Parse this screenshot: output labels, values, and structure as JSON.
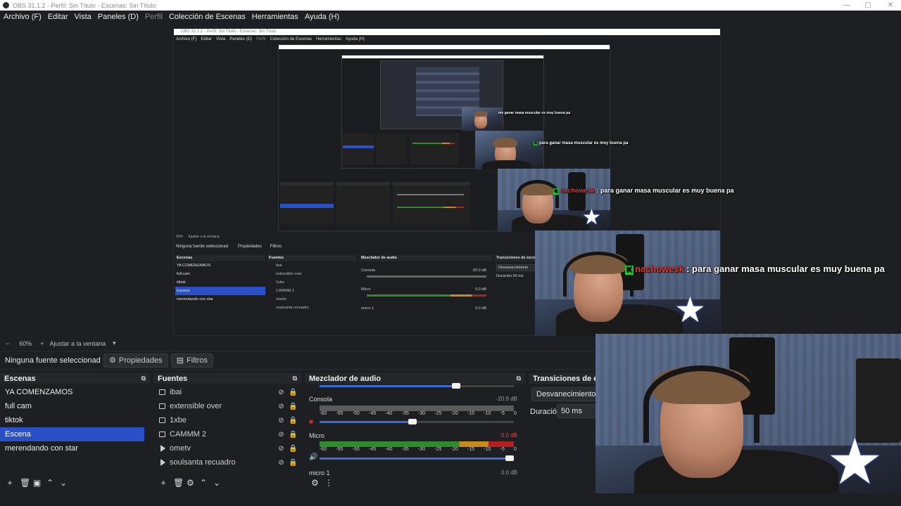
{
  "window": {
    "title": "OBS 31.1.2 - Perfil: Sin Título - Escenas: Sin Título"
  },
  "menu": [
    {
      "label": "Archivo (F)",
      "dim": false
    },
    {
      "label": "Editar",
      "dim": false
    },
    {
      "label": "Vista",
      "dim": false
    },
    {
      "label": "Paneles (D)",
      "dim": false
    },
    {
      "label": "Perfil",
      "dim": true
    },
    {
      "label": "Colección de Escenas",
      "dim": false
    },
    {
      "label": "Herramientas",
      "dim": false
    },
    {
      "label": "Ayuda (H)",
      "dim": false
    }
  ],
  "chat": {
    "username": "nachowesk",
    "message": ": para ganar masa muscular es muy buena pa",
    "badge": "K",
    "message_small": "para ganar masa muscular es muy buena pa",
    "message_tiny": "me ganar masa muscular es muy buena pa"
  },
  "zoom": {
    "percent": "60%",
    "add": "+",
    "fit_label": "Ajustar a la ventana"
  },
  "source_toolbar": {
    "no_source": "Ninguna fuente seleccionad",
    "properties": "Propiedades",
    "filters": "Filtros"
  },
  "scenes": {
    "title": "Escenas",
    "items": [
      {
        "label": "YA COMENZAMOS",
        "selected": false
      },
      {
        "label": "full cam",
        "selected": false
      },
      {
        "label": "tiktok",
        "selected": false
      },
      {
        "label": "Escena",
        "selected": true
      },
      {
        "label": "merendando con star",
        "selected": false
      }
    ]
  },
  "sources": {
    "title": "Fuentes",
    "items": [
      {
        "label": "ibai",
        "icon": "window"
      },
      {
        "label": "extensible over",
        "icon": "window"
      },
      {
        "label": "1xbe",
        "icon": "window"
      },
      {
        "label": "CAMMM 2",
        "icon": "window"
      },
      {
        "label": "ometv",
        "icon": "play"
      },
      {
        "label": "soulsanta recuadro",
        "icon": "play"
      }
    ]
  },
  "mixer": {
    "title": "Mezclador de audio",
    "scale": [
      "-60",
      "-55",
      "-50",
      "-45",
      "-40",
      "-35",
      "-30",
      "-25",
      "-20",
      "-15",
      "-10",
      "-5",
      "0"
    ],
    "channels": [
      {
        "name": "Consola",
        "db": "-20.9 dB",
        "volume": 0.48,
        "muted": true
      },
      {
        "name": "Micro",
        "db": "0.0 dB",
        "volume": 1.0,
        "muted": false
      },
      {
        "name": "micro 1",
        "db": "0.0 dB"
      }
    ]
  },
  "transitions": {
    "title": "Transiciones de esce",
    "selected": "Desvanecimiento",
    "duration_label": "Duración",
    "duration_value": "50 ms"
  },
  "nested": {
    "title": "OBS 31.1.2 - Perfil: Sin Título - Escenas: Sin Título",
    "menu": [
      "Archivo (F)",
      "Editar",
      "Vista",
      "Paneles (D)",
      "Perfil",
      "Colección de Escenas",
      "Herramientas",
      "Ayuda (H)"
    ],
    "zoom": "60%",
    "fit": "Ajustar a la ventana",
    "no_source": "Ninguna fuente seleccionad",
    "properties": "Propiedades",
    "filters": "Filtros",
    "scenes_title": "Escenas",
    "sources_title": "Fuentes",
    "mixer_title": "Mezclador de audio",
    "transitions_title": "Transiciones de esce",
    "transition_selected": "Desvanecimiento",
    "duration": "Duración",
    "duration_value": "50 ms",
    "consola": "Consola",
    "micro": "Micro",
    "micro1": "micro 1",
    "db1": "-20.0 dB",
    "db2": "0.0 dB",
    "db3": "0.0 dB",
    "scenes": [
      "YA COMENZAMOS",
      "full cam",
      "tiktok",
      "Escena",
      "merendando con star"
    ],
    "sources": [
      "ibai",
      "extensible over",
      "1xbe",
      "CAMMM 2",
      "ometv",
      "soulsanta recuadro"
    ]
  },
  "colors": {
    "accent": "#2a50c8",
    "panel": "#1e1f22",
    "header": "#25272b",
    "chat_user": "#e03a3a",
    "badge": "#1fcf2f"
  }
}
